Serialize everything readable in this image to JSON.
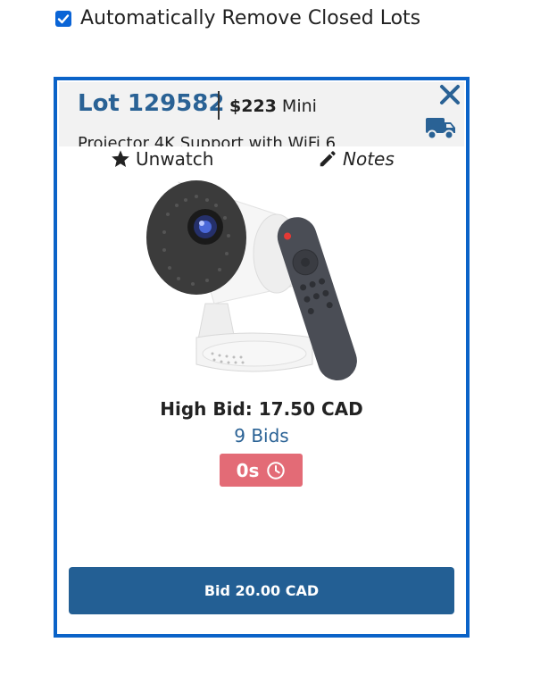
{
  "auto_remove": {
    "label": "Automatically Remove Closed Lots",
    "checked": true
  },
  "lot": {
    "number_label": "Lot 129582",
    "price_prefix": "$223",
    "price_suffix": " Mini",
    "title": "Projector 4K Support with WiFi 6",
    "high_bid": "High Bid: 17.50 CAD",
    "bids": "9 Bids",
    "timer": "0s",
    "bid_button": "Bid 20.00 CAD"
  },
  "actions": {
    "unwatch": "Unwatch",
    "notes": "Notes"
  },
  "icons": {
    "close": "close-icon",
    "shipping": "truck-icon",
    "unwatch": "star-icon",
    "notes": "pencil-icon",
    "timer": "clock-icon"
  },
  "colors": {
    "accent_blue": "#2a6295",
    "card_border": "#0b63c8",
    "timer_badge": "#e36b76",
    "bid_button": "#235f94",
    "checkbox": "#0a64d6"
  }
}
